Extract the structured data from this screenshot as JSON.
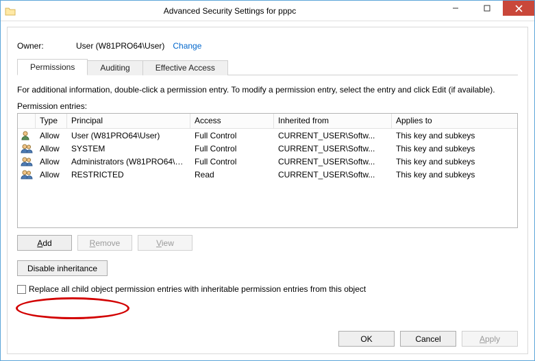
{
  "window": {
    "title": "Advanced Security Settings for pppc"
  },
  "owner": {
    "label": "Owner:",
    "value": "User (W81PRO64\\User)",
    "change": "Change"
  },
  "tabs": {
    "permissions": "Permissions",
    "auditing": "Auditing",
    "effective": "Effective Access"
  },
  "info_text": "For additional information, double-click a permission entry. To modify a permission entry, select the entry and click Edit (if available).",
  "entries_label": "Permission entries:",
  "columns": {
    "type": "Type",
    "principal": "Principal",
    "access": "Access",
    "inherited": "Inherited from",
    "applies": "Applies to"
  },
  "rows": [
    {
      "icon": "person",
      "type": "Allow",
      "principal": "User (W81PRO64\\User)",
      "access": "Full Control",
      "inherited": "CURRENT_USER\\Softw...",
      "applies": "This key and subkeys"
    },
    {
      "icon": "persons",
      "type": "Allow",
      "principal": "SYSTEM",
      "access": "Full Control",
      "inherited": "CURRENT_USER\\Softw...",
      "applies": "This key and subkeys"
    },
    {
      "icon": "persons",
      "type": "Allow",
      "principal": "Administrators (W81PRO64\\A...",
      "access": "Full Control",
      "inherited": "CURRENT_USER\\Softw...",
      "applies": "This key and subkeys"
    },
    {
      "icon": "persons",
      "type": "Allow",
      "principal": "RESTRICTED",
      "access": "Read",
      "inherited": "CURRENT_USER\\Softw...",
      "applies": "This key and subkeys"
    }
  ],
  "buttons": {
    "add": "Add",
    "remove": "Remove",
    "view": "View",
    "disable_inheritance": "Disable inheritance",
    "ok": "OK",
    "cancel": "Cancel",
    "apply": "Apply"
  },
  "checkbox": {
    "replace": "Replace all child object permission entries with inheritable permission entries from this object"
  }
}
